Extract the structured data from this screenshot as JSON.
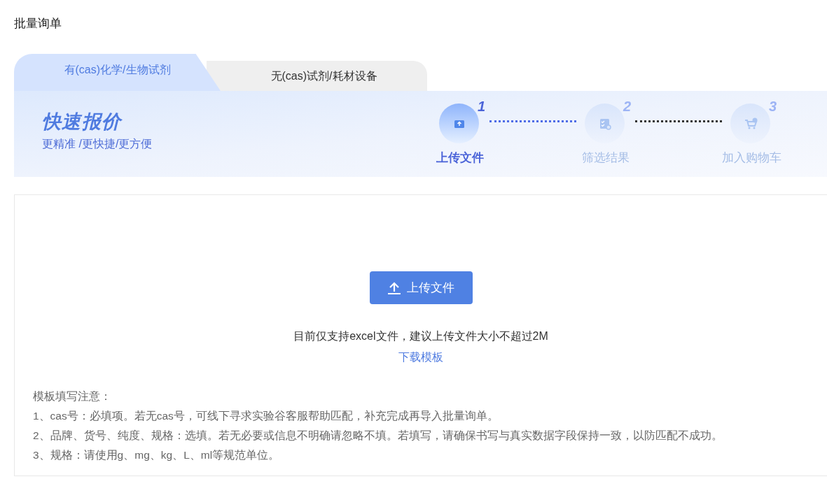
{
  "page_title": "批量询单",
  "tabs": [
    {
      "label": "有(cas)化学/生物试剂",
      "selected": true
    },
    {
      "label": "无(cas)试剂/耗材设备",
      "selected": false
    }
  ],
  "banner": {
    "title": "快速报价",
    "subtitle": "更精准 /更快捷/更方便"
  },
  "steps": [
    {
      "number": "1",
      "label": "上传文件",
      "active": true
    },
    {
      "number": "2",
      "label": "筛选结果",
      "active": false
    },
    {
      "number": "3",
      "label": "加入购物车",
      "active": false
    }
  ],
  "upload": {
    "button": "上传文件",
    "hint": "目前仅支持excel文件，建议上传文件大小不超过2M",
    "template_link": "下载模板"
  },
  "notes": {
    "heading": "模板填写注意：",
    "items": [
      "1、cas号：必填项。若无cas号，可线下寻求实验谷客服帮助匹配，补充完成再导入批量询单。",
      "2、品牌、货号、纯度、规格：选填。若无必要或信息不明确请忽略不填。若填写，请确保书写与真实数据字段保持一致，以防匹配不成功。",
      "3、规格：请使用g、mg、kg、L、ml等规范单位。"
    ]
  }
}
